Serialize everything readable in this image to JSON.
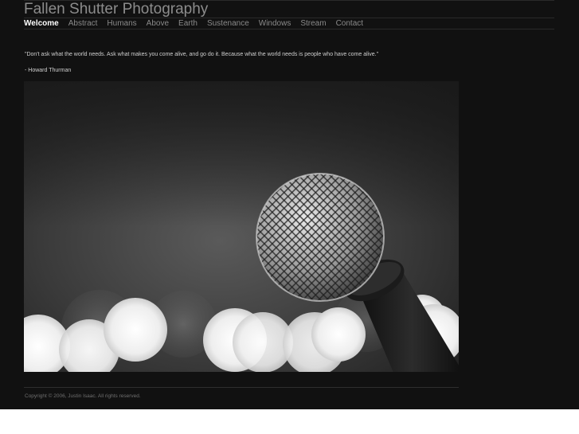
{
  "site": {
    "title": "Fallen Shutter Photography"
  },
  "nav": {
    "items": [
      {
        "label": "Welcome",
        "active": true
      },
      {
        "label": "Abstract"
      },
      {
        "label": "Humans"
      },
      {
        "label": "Above"
      },
      {
        "label": "Earth"
      },
      {
        "label": "Sustenance"
      },
      {
        "label": "Windows"
      },
      {
        "label": "Stream"
      },
      {
        "label": "Contact"
      }
    ]
  },
  "content": {
    "quote": "\"Don't ask what the world needs. Ask what makes you come alive, and go do it. Because what the world needs is people who have come alive.\"",
    "author": "- Howard Thurman",
    "photo_icon": "microphone-bokeh-photo"
  },
  "footer": {
    "copyright": "Copyright © 2006, Justin Isaac. All rights reserved."
  },
  "colors": {
    "page_background": "#111111",
    "active_nav": "#ffffff",
    "inactive_nav": "#8a8a8a",
    "title": "#8c8c8c"
  }
}
